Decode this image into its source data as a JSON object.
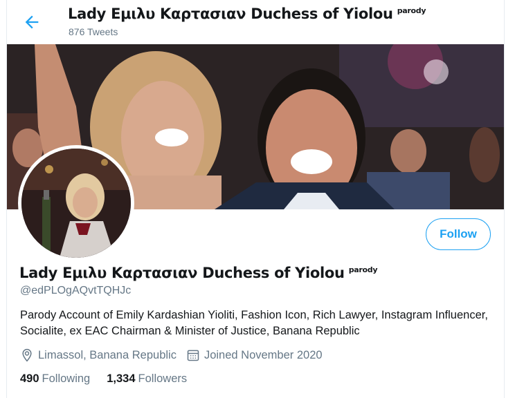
{
  "header": {
    "title": "Lady Εμιλυ Καρτασιαν Duchess of Yiolou",
    "badge": "parody",
    "tweet_count": "876 Tweets",
    "back_icon": "arrow-left-icon"
  },
  "profile": {
    "name": "Lady Εμιλυ Καρτασιαν Duchess of Yiolou",
    "badge": "parody",
    "handle": "@edPLOgAQvtTQHJc",
    "bio": "Parody Account of Emily Kardashian Yioliti, Fashion Icon, Rich Lawyer, Instagram Influencer, Socialite,  ex EAC Chairman & Minister of Justice, Banana Republic",
    "location": "Limassol, Banana Republic",
    "joined": "Joined November 2020",
    "following_count": "490",
    "following_label": "Following",
    "followers_count": "1,334",
    "followers_label": "Followers",
    "follow_button": "Follow"
  },
  "colors": {
    "accent": "#1da1f2",
    "secondary_text": "#657786",
    "primary_text": "#14171a"
  }
}
